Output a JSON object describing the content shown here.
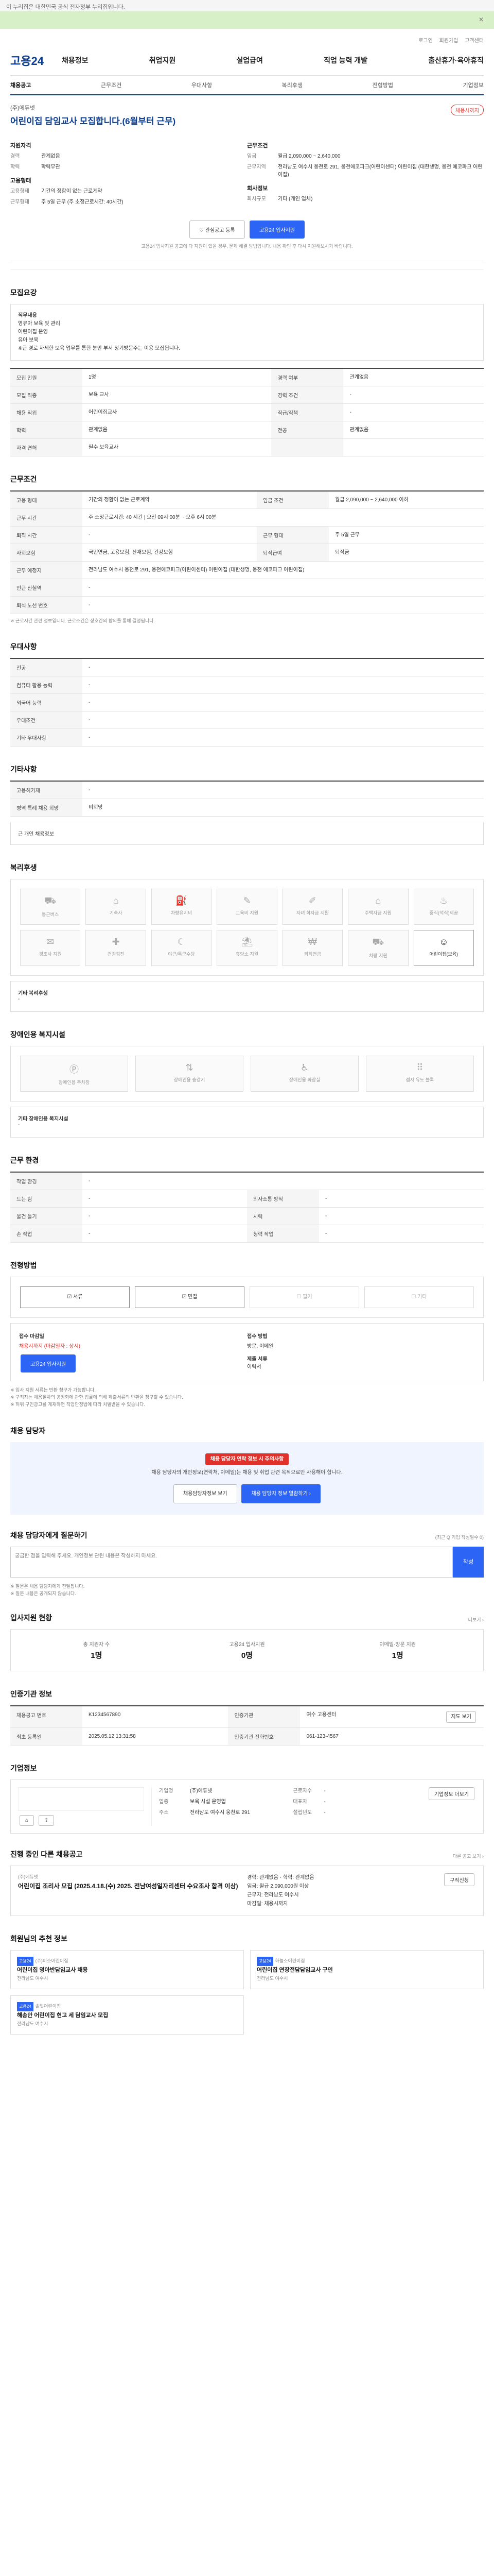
{
  "topbar": {
    "text": "이 누리집은 대한민국 공식 전자정부 누리집입니다."
  },
  "util": [
    "로그인",
    "회원가입",
    "고객센터"
  ],
  "logo": "고용24",
  "gnb": [
    "채용정보",
    "취업지원",
    "실업급여",
    "직업 능력 개발",
    "출산휴가·육아휴직"
  ],
  "tabs": [
    "채용공고",
    "근무조건",
    "우대사항",
    "복리후생",
    "전형방법",
    "기업정보"
  ],
  "job": {
    "company": "(주)에듀넷",
    "title": "어린이집 담임교사 모집합니다.(6월부터 근무)",
    "badge": "채용시까지"
  },
  "summary": {
    "left_title": "지원자격",
    "left": [
      {
        "k": "경력",
        "v": "관계없음"
      },
      {
        "k": "학력",
        "v": "학력무관"
      }
    ],
    "left2_title": "고용형태",
    "left2": [
      {
        "k": "고용형태",
        "v": "기간의 정함이 없는 근로계약"
      },
      {
        "k": "근무형태",
        "v": "주 5일 근무 (주 소정근로시간: 40시간)"
      }
    ],
    "right_title": "근무조건",
    "right": [
      {
        "k": "임금",
        "v": "월급 2,090,000 ~ 2,640,000"
      },
      {
        "k": "근무지역",
        "v": "전라남도 여수시 웅천로 291, 웅천에코파크(어린이센터) 어린이집 (대한생명, 웅천 에코파크 어린이집)"
      }
    ],
    "right2_title": "회사정보",
    "right2": [
      {
        "k": "회사규모",
        "v": "기타 (개인 업체)"
      }
    ]
  },
  "actions": {
    "interest": "관심공고 등록",
    "apply": "고용24 입사지원",
    "note": "고용24 입사지원 공고에 다 지원이 있을 경우, 문제 해결 방법입니다. 내용 확인 후 다시 지원해보시기 바랍니다."
  },
  "sec_recruit": "모집요강",
  "duty": {
    "title": "직무내용",
    "lines": [
      "영유아 보육 및 관리",
      "어린이집 운영",
      "유아 보육",
      "",
      "※근 경로 자세한 보육 업무를 통한 분만 부서 정기방문주는 이용 모집됩니다."
    ]
  },
  "recruit_rows": [
    {
      "k1": "모집 인원",
      "v1": "1명",
      "k2": "경력 여부",
      "v2": "관계없음"
    },
    {
      "k1": "모집 직종",
      "v1": "보육 교사",
      "k2": "경력 조건",
      "v2": "-"
    },
    {
      "k1": "채용 직위",
      "v1": "어린이집교사",
      "k2": "직급/직책",
      "v2": "-"
    },
    {
      "k1": "학력",
      "v1": "관계없음",
      "k2": "전공",
      "v2": "관계없음"
    },
    {
      "k1": "자격 면허",
      "v1": "필수  보육교사",
      "k2": "",
      "v2": ""
    }
  ],
  "sec_cond": "근무조건",
  "cond_rows": [
    {
      "k": "고용 형태",
      "v": "기간의 정함이 없는 근로계약",
      "k2": "임금 조건",
      "v2": "월급 2,090,000 ~ 2,640,000 이하"
    },
    {
      "k": "근무 시간",
      "v": "주 소정근로시간: 40 시간 | 오전 09시 00분 ~ 오후 6시 00분",
      "k2": "",
      "v2": ""
    },
    {
      "k": "퇴직 시간",
      "v": "-",
      "k2": "근무 형태",
      "v2": "주 5일 근무"
    },
    {
      "k": "사회보험",
      "v": "국민연금, 고용보험, 산재보험, 건강보험",
      "k2": "퇴직급여",
      "v2": "퇴직금"
    },
    {
      "k": "근무 예정지",
      "v": "전라남도 여수시 웅천로 291, 웅천에코파크(어린이센터) 어린이집 (대한생명, 웅천 에코파크 어린이집)",
      "k2": "",
      "v2": ""
    },
    {
      "k": "인근 전철역",
      "v": "-",
      "k2": "",
      "v2": ""
    },
    {
      "k": "퇴식 노선 번호",
      "v": "-",
      "k2": "",
      "v2": ""
    }
  ],
  "cond_note": "※ 근로시간 관련 정보입니다. 근로조건은 상호간의 합의를 통해 결정됩니다.",
  "sec_pref": "우대사항",
  "pref_rows": [
    {
      "k": "전공",
      "v": "-"
    },
    {
      "k": "컴퓨터 활용 능력",
      "v": "-"
    },
    {
      "k": "외국어 능력",
      "v": "-"
    },
    {
      "k": "우대조건",
      "v": "-"
    },
    {
      "k": "기타 우대사항",
      "v": "-"
    }
  ],
  "sec_etc": "기타사항",
  "etc_rows": [
    {
      "k": "고용허가제",
      "v": "-"
    },
    {
      "k": "병역 특례 채용 희망",
      "v": "비희망"
    }
  ],
  "etc_box": "근 개인 채용정보",
  "sec_welfare": "복리후생",
  "welfare": [
    {
      "label": "통근버스",
      "on": false
    },
    {
      "label": "기숙사",
      "on": false
    },
    {
      "label": "차량유지비",
      "on": false
    },
    {
      "label": "교육비 지원",
      "on": false
    },
    {
      "label": "자녀 학자금 지원",
      "on": false
    },
    {
      "label": "주택자금 지원",
      "on": false
    },
    {
      "label": "중식(석식)제공",
      "on": false
    },
    {
      "label": "경조사 지원",
      "on": false
    },
    {
      "label": "건강검진",
      "on": false
    },
    {
      "label": "야근/특근수당",
      "on": false
    },
    {
      "label": "휴양소 지원",
      "on": false
    },
    {
      "label": "퇴직연금",
      "on": false
    },
    {
      "label": "차량 지원",
      "on": false
    },
    {
      "label": "어린이집(보육)",
      "on": true
    }
  ],
  "welfare_other_title": "기타 복리후생",
  "sec_disab": "장애인용 복지시설",
  "disab": [
    "장애인용 주차장",
    "장애인용 승강기",
    "장애인용 화장실",
    "점자 유도 블록"
  ],
  "disab_other_title": "기타 장애인용 복지시설",
  "sec_etc_rows": "근무 환경",
  "env_rows": [
    {
      "k": "작업 환경",
      "v": "-",
      "k2": "",
      "v2": ""
    },
    {
      "k": "드는 힘",
      "v": "-",
      "k2": "의사소통 방식",
      "v2": "-"
    },
    {
      "k": "물건 들기",
      "v": "-",
      "k2": "시력",
      "v2": "-"
    },
    {
      "k": "손 작업",
      "v": "-",
      "k2": "청력 작업",
      "v2": "-"
    }
  ],
  "sec_method": "전형방법",
  "modes": [
    {
      "label": "서류",
      "on": true
    },
    {
      "label": "면접",
      "on": true
    },
    {
      "label": "필기",
      "on": false
    },
    {
      "label": "기타",
      "on": false
    }
  ],
  "submit": {
    "k1": "접수 마감일",
    "v1": "채용시까지 (마감일자 : 상시)",
    "k2": "접수 방법",
    "v2": "방문, 이메일",
    "apply": "고용24 입사지원",
    "k3": "제출 서류",
    "v3": "이력서"
  },
  "submit_notes": [
    "※ 입사 지원 서류는 반환 청구가 가능합니다.",
    "※ 구직자는 채용절차의 공정화에 관한 법률에 의해 제출서류의 반환을 청구할 수 있습니다.",
    "※ 허위 구인광고를 게재하면 직업안정법에 따라 처벌받을 수 있습니다."
  ],
  "sec_contact": "채용 담당자",
  "contact": {
    "tag": "채용 담당자 연락 정보 시 주의사항",
    "text": "채용 담당자의 개인정보(연락처, 이메일)는 채용 및 취업 관련 목적으로만 사용해야 합니다.",
    "btn1": "채용담당자정보 보기",
    "btn2": "채용 담당자 정보 열람하기 ›"
  },
  "qa": {
    "title": "채용 담당자에게 질문하기",
    "right": "(최근 Q 기업 작성일수 0)",
    "placeholder": "궁금한 점을 입력해 주세요. 개인정보 관련 내용은 작성하지 마세요.",
    "send": "작성"
  },
  "qa_notes": [
    "※ 질문은 채용 담당자에게 전달됩니다.",
    "※ 질문 내용은 공개되지 않습니다."
  ],
  "sec_stats": "입사지원 현황",
  "stats_more": "더보기 ›",
  "stats": [
    {
      "k": "총 지원자 수",
      "v": "1명"
    },
    {
      "k": "고용24 입사지원",
      "v": "0명"
    },
    {
      "k": "이메일·방문 지원",
      "v": "1명"
    }
  ],
  "sec_org": "인증기관 정보",
  "org_rows": [
    {
      "k": "채용공고 번호",
      "v": "K1234567890",
      "k2": "인증기관",
      "v2": "여수 고용센터",
      "btn": "지도 보기"
    },
    {
      "k": "최초 등록일",
      "v": "2025.05.12 13:31:58",
      "k2": "인증기관 전화번호",
      "v2": "061-123-4567",
      "btn": ""
    }
  ],
  "sec_company": "기업정보",
  "company": {
    "rows": [
      {
        "k": "기업명",
        "v": "(주)에듀넷"
      },
      {
        "k": "업종",
        "v": "보육 시설 운영업"
      },
      {
        "k": "주소",
        "v": "전라남도 여수시 웅천로 291"
      }
    ],
    "rows2": [
      {
        "k": "근로자수",
        "v": "-"
      },
      {
        "k": "대표자",
        "v": "-"
      },
      {
        "k": "설립년도",
        "v": "-"
      }
    ],
    "btn": "기업정보 더보기"
  },
  "sec_ongoing": "진행 중인 다른 채용공고",
  "ongoing": {
    "more": "다른 공고 보기 ›",
    "company": "(주)에듀넷",
    "title": "어린이집 조리사 모집 (2025.4.18.(수) 2025. 전남여성일자리센터 수요조사 합격 이상)",
    "lines": [
      "경력: 관계없음 · 학력: 관계없음",
      "임금: 월급 2,090,000원 이상",
      "근무지: 전라남도 여수시",
      "마감일: 채용시까지"
    ],
    "btn": "구직신청"
  },
  "sec_rec": "회원님의 추천 정보",
  "rec": [
    {
      "badge": "고용24",
      "company": "(주)미소어린이집",
      "title": "어린이집 영아반담임교사 채용",
      "loc": "전라남도 여수시"
    },
    {
      "badge": "고용24",
      "company": "하늘소어린이집",
      "title": "어린이집 연장전담담임교사 구인",
      "loc": "전라남도 여수시"
    },
    {
      "badge": "고용24",
      "company": "솔빛어린이집",
      "title": "해송안 어린이집 현고 세 담임교사 모집",
      "loc": "전라남도 여수시"
    }
  ]
}
